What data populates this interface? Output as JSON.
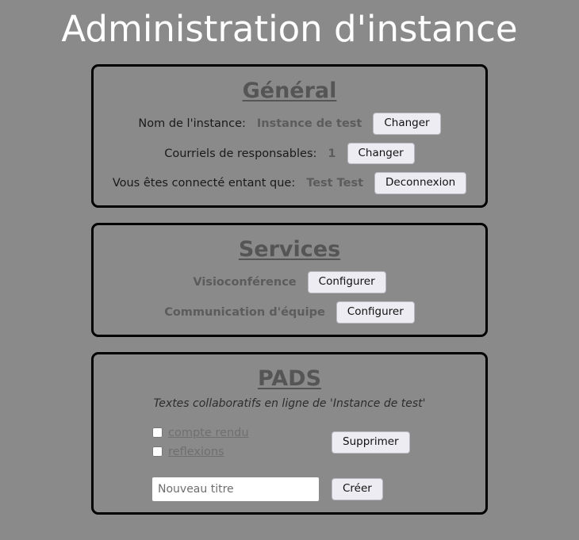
{
  "page": {
    "title": "Administration d'instance",
    "background_color": "#8a8a8a",
    "title_color": "#ffffff"
  },
  "general": {
    "title": "Général",
    "rows": [
      {
        "label": "Nom de l'instance:",
        "value": "Instance de test",
        "button": "Changer"
      },
      {
        "label": "Courriels de responsables:",
        "value": "1",
        "button": "Changer"
      },
      {
        "label": "Vous êtes connecté entant que:",
        "value": "Test Test",
        "button": "Deconnexion"
      }
    ]
  },
  "services": {
    "title": "Services",
    "rows": [
      {
        "name": "Visioconférence",
        "button": "Configurer"
      },
      {
        "name": "Communication d'équipe",
        "button": "Configurer"
      }
    ]
  },
  "pads": {
    "title": "PADS",
    "subtitle": "Textes collaboratifs en ligne de 'Instance de test'",
    "items": [
      {
        "label": "compte rendu",
        "checked": false
      },
      {
        "label": "reflexions",
        "checked": false
      }
    ],
    "delete_button": "Supprimer",
    "new_title_placeholder": "Nouveau titre",
    "new_title_value": "",
    "create_button": "Créer"
  },
  "colors": {
    "button_bg": "#ececf2",
    "value_text": "#5c5c5c",
    "label_text": "#1a1a1a",
    "link_text": "#6f6f6f",
    "card_border": "#000000"
  }
}
